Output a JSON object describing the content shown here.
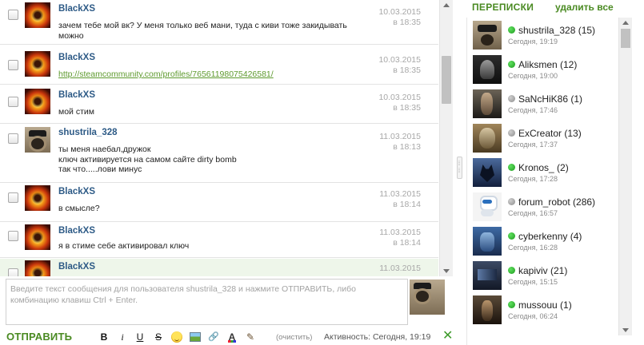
{
  "messages": [
    {
      "author": "BlackXS",
      "text": [
        "зачем тебе мой вк? У меня только веб мани, туда с киви тоже закидывать",
        "можно"
      ],
      "date": "10.03.2015",
      "time": "в 18:35",
      "avatar": "fire-avatar"
    },
    {
      "author": "BlackXS",
      "link": "http://steamcommunity.com/profiles/76561198075426581/",
      "date": "10.03.2015",
      "time": "в 18:35",
      "avatar": "fire-avatar"
    },
    {
      "author": "BlackXS",
      "text": [
        "мой стим"
      ],
      "date": "10.03.2015",
      "time": "в 18:35",
      "avatar": "fire-avatar"
    },
    {
      "author": "shustrila_328",
      "text": [
        "ты меня наебал,дружок",
        "ключ активируется на самом сайте dirty bomb",
        "так что.....лови минус"
      ],
      "date": "11.03.2015",
      "time": "в 18:13",
      "avatar": "pug-avatar"
    },
    {
      "author": "BlackXS",
      "text": [
        "в смысле?"
      ],
      "date": "11.03.2015",
      "time": "в 18:14",
      "avatar": "fire-avatar"
    },
    {
      "author": "BlackXS",
      "text": [
        "я в стиме себе активировал ключ"
      ],
      "date": "11.03.2015",
      "time": "в 18:14",
      "avatar": "fire-avatar"
    },
    {
      "author": "BlackXS",
      "text": [],
      "date": "11.03.2015",
      "time": "",
      "avatar": "fire-avatar"
    }
  ],
  "compose": {
    "placeholder": "Введите текст сообщения для пользователя shustrila_328 и нажмите ОТПРАВИТЬ, либо комбинацию клавиш Ctrl + Enter.",
    "value": ""
  },
  "toolbar": {
    "send_label": "ОТПРАВИТЬ",
    "bold": "B",
    "italic": "i",
    "underline": "U",
    "strike": "S",
    "link_glyph": "🔗",
    "color_glyph": "A",
    "quote_glyph": "✎",
    "clear_label": "(очистить)",
    "activity": "Активность: Сегодня, 19:19",
    "close_glyph": "✕",
    "icons": [
      "bold-icon",
      "italic-icon",
      "underline-icon",
      "strikethrough-icon",
      "smiley-icon",
      "image-icon",
      "link-icon",
      "text-color-icon",
      "quote-icon"
    ]
  },
  "dialogs": {
    "title": "ПЕРЕПИСКИ",
    "delete_all": "удалить все",
    "items": [
      {
        "name": "shustrila_328 (15)",
        "time": "Сегодня, 19:19",
        "online": true,
        "avatar": "pug-avatar"
      },
      {
        "name": "Aliksmen (12)",
        "time": "Сегодня, 19:00",
        "online": true,
        "avatar": "soldier-avatar"
      },
      {
        "name": "SaNcHiK86 (1)",
        "time": "Сегодня, 17:46",
        "online": false,
        "avatar": "man-avatar"
      },
      {
        "name": "ExCreator (13)",
        "time": "Сегодня, 17:37",
        "online": false,
        "avatar": "creator-avatar"
      },
      {
        "name": "Kronos_ (2)",
        "time": "Сегодня, 17:28",
        "online": true,
        "avatar": "wolf-avatar"
      },
      {
        "name": "forum_robot (286)",
        "time": "Сегодня, 16:57",
        "online": false,
        "avatar": "robot-avatar"
      },
      {
        "name": "cyberkenny (4)",
        "time": "Сегодня, 16:28",
        "online": true,
        "avatar": "cyber-avatar"
      },
      {
        "name": "kapiviv (21)",
        "time": "Сегодня, 15:15",
        "online": true,
        "avatar": "kapiviv-avatar"
      },
      {
        "name": "mussouu (1)",
        "time": "Сегодня, 06:24",
        "online": true,
        "avatar": "mussou-avatar"
      }
    ]
  },
  "colors": {
    "accent_green": "#4a8a22",
    "link_green": "#5e9a2e",
    "author_blue": "#2d5a86",
    "date_gray": "#a8a8a8"
  }
}
